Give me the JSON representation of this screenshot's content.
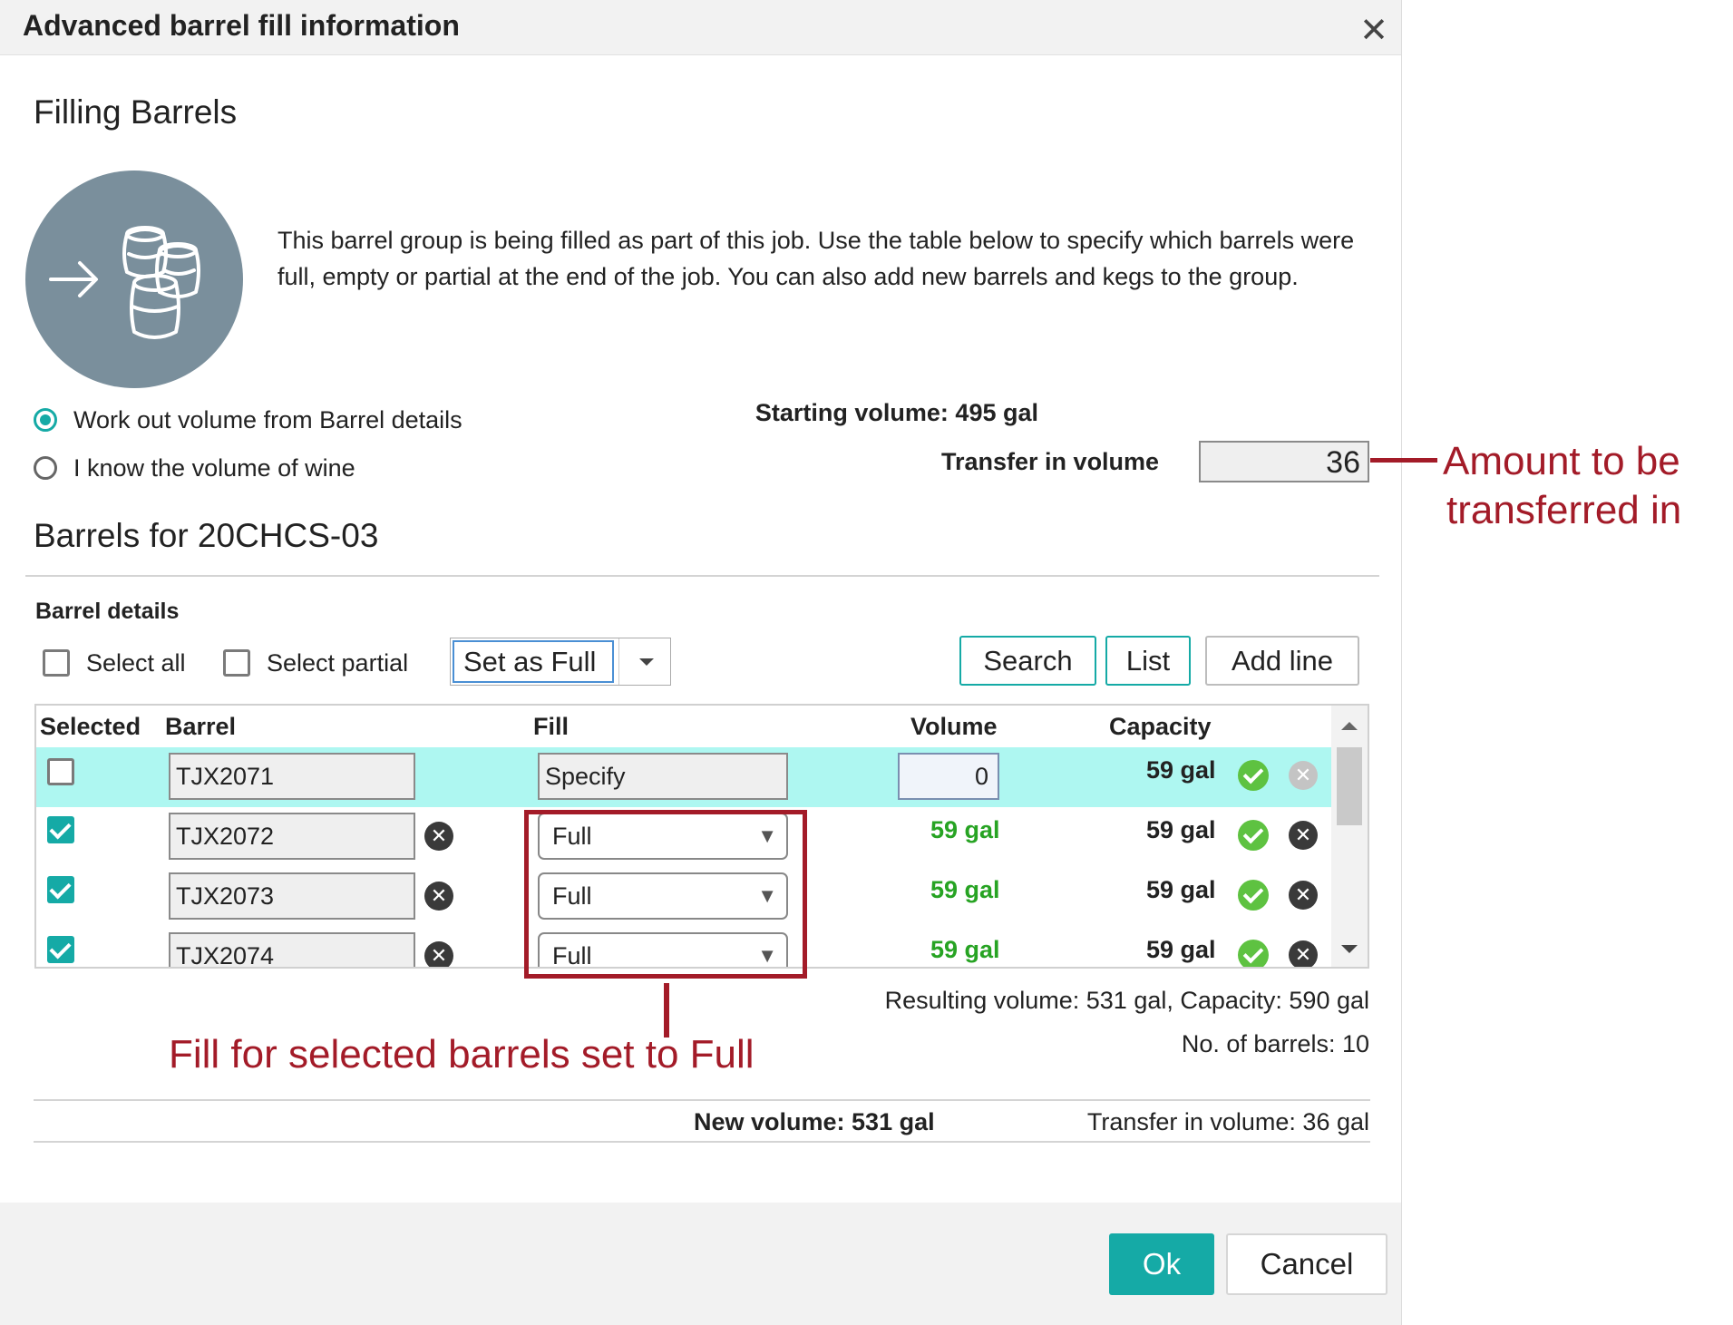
{
  "dialog": {
    "title": "Advanced barrel fill information",
    "close_icon": "close-icon"
  },
  "filling": {
    "heading": "Filling Barrels",
    "icon": "barrels-transfer-icon",
    "intro": "This barrel group is being filled as part of this job. Use the table below to specify which barrels were full, empty or partial at the end of the job. You can also add new barrels and kegs to the group."
  },
  "mode": {
    "options": [
      {
        "label": "Work out volume from Barrel details",
        "selected": true
      },
      {
        "label": "I know the volume of wine",
        "selected": false
      }
    ]
  },
  "volumes": {
    "starting_label": "Starting volume: 495 gal",
    "transfer_label": "Transfer in volume",
    "transfer_value": "36"
  },
  "annotations": {
    "transfer_line1": "Amount to be",
    "transfer_line2": "transferred in",
    "fill_note": "Fill for selected barrels set to Full"
  },
  "barrels": {
    "heading": "Barrels for 20CHCS-03",
    "details_label": "Barrel details",
    "select_all": "Select all",
    "select_partial": "Select partial",
    "set_as_value": "Set as Full",
    "buttons": {
      "search": "Search",
      "list": "List",
      "add_line": "Add line"
    },
    "columns": [
      "Selected",
      "Barrel",
      "Fill",
      "Volume",
      "Capacity"
    ],
    "rows": [
      {
        "selected": false,
        "barrel": "TJX2071",
        "fill": "Specify",
        "volume": "0",
        "capacity": "59 gal"
      },
      {
        "selected": true,
        "barrel": "TJX2072",
        "fill": "Full",
        "volume": "59 gal",
        "capacity": "59 gal"
      },
      {
        "selected": true,
        "barrel": "TJX2073",
        "fill": "Full",
        "volume": "59 gal",
        "capacity": "59 gal"
      },
      {
        "selected": true,
        "barrel": "TJX2074",
        "fill": "Full",
        "volume": "59 gal",
        "capacity": "59 gal"
      }
    ],
    "resulting": "Resulting volume: 531 gal, Capacity: 590 gal",
    "count": "No. of barrels: 10"
  },
  "totals": {
    "new_volume": "New volume: 531 gal",
    "transfer_in": "Transfer in volume: 36 gal"
  },
  "footer": {
    "ok": "Ok",
    "cancel": "Cancel"
  },
  "colors": {
    "accent": "#15aaa6",
    "annotation": "#a31b28",
    "highlight_row": "#aef7f1",
    "volume_green": "#27a323"
  }
}
